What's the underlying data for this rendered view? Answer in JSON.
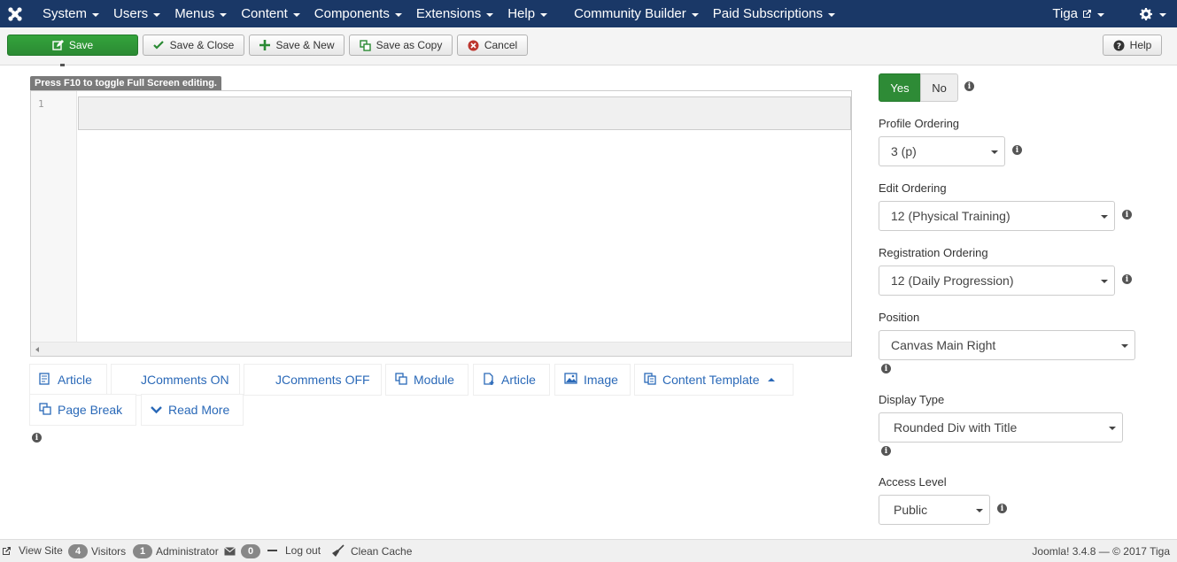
{
  "navbar": {
    "menus": [
      "System",
      "Users",
      "Menus",
      "Content",
      "Components",
      "Extensions",
      "Help"
    ],
    "extra_menus": [
      "Community Builder",
      "Paid Subscriptions"
    ],
    "user": "Tiga"
  },
  "toolbar": {
    "save": "Save",
    "save_close": "Save & Close",
    "save_new": "Save & New",
    "save_copy": "Save as Copy",
    "cancel": "Cancel",
    "help": "Help"
  },
  "editor": {
    "tip": "Press F10 to toggle Full Screen editing.",
    "line_number": "1"
  },
  "editor_buttons": {
    "article1": "Article",
    "jcomments_on": "JComments ON",
    "jcomments_off": "JComments OFF",
    "module": "Module",
    "article2": "Article",
    "image": "Image",
    "content_template": "Content Template",
    "page_break": "Page Break",
    "read_more": "Read More"
  },
  "right_panel": {
    "yes": "Yes",
    "no": "No",
    "profile_ordering": {
      "label": "Profile Ordering",
      "value": "3 (p)"
    },
    "edit_ordering": {
      "label": "Edit Ordering",
      "value": "12 (Physical Training)"
    },
    "registration_ordering": {
      "label": "Registration Ordering",
      "value": "12 (Daily Progression)"
    },
    "position": {
      "label": "Position",
      "value": "Canvas Main Right"
    },
    "display_type": {
      "label": "Display Type",
      "value": "Rounded Div with Title"
    },
    "access_level": {
      "label": "Access Level",
      "value": "Public"
    }
  },
  "statusbar": {
    "view_site": "View Site",
    "visitors_count": "4",
    "visitors": "Visitors",
    "admin_count": "1",
    "administrator": "Administrator",
    "messages_count": "0",
    "logout": "Log out",
    "clean_cache": "Clean Cache",
    "version": "Joomla! 3.4.8  —  © 2017 Tiga"
  }
}
